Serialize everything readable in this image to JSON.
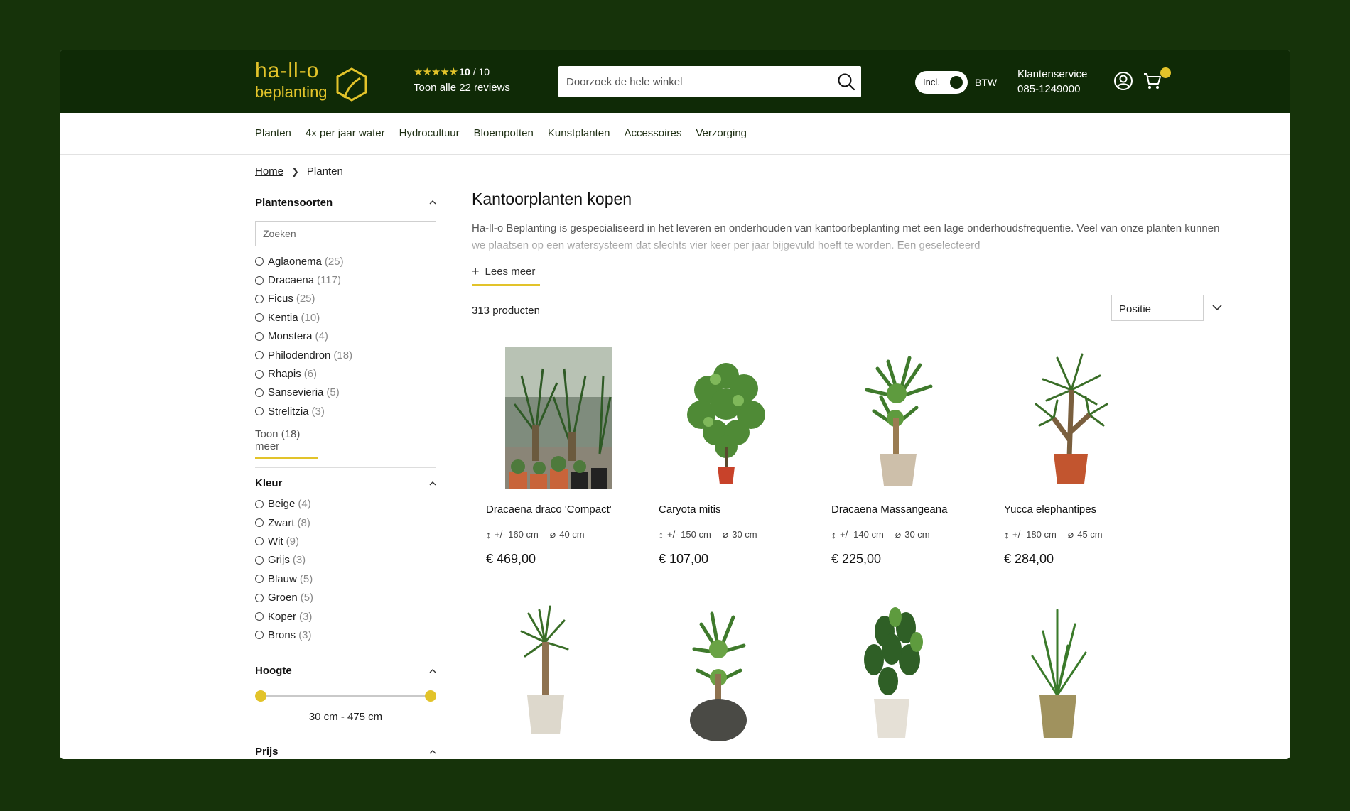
{
  "colors": {
    "header_bg": "#0f2a06",
    "accent": "#e2c32a",
    "page_bg": "#16330a"
  },
  "logo": {
    "line1": "ha-ll-o",
    "line2": "beplanting"
  },
  "rating": {
    "stars": "★★★★★",
    "score": "10",
    "out_of": "/ 10",
    "reviews_link": "Toon alle 22 reviews"
  },
  "search": {
    "placeholder": "Doorzoek de hele winkel",
    "icon": "search-icon"
  },
  "vat_toggle": {
    "label": "Incl.",
    "suffix": "BTW",
    "state": "on"
  },
  "service": {
    "title": "Klantenservice",
    "phone": "085-1249000"
  },
  "header_icons": [
    "user-icon",
    "cart-icon"
  ],
  "nav": {
    "items": [
      "Planten",
      "4x per jaar water",
      "Hydrocultuur",
      "Bloempotten",
      "Kunstplanten",
      "Accessoires",
      "Verzorging"
    ]
  },
  "breadcrumb": {
    "home": "Home",
    "current": "Planten"
  },
  "filters": {
    "plant_types": {
      "title": "Plantensoorten",
      "search_placeholder": "Zoeken",
      "options": [
        {
          "label": "Aglaonema",
          "count": "(25)"
        },
        {
          "label": "Dracaena",
          "count": "(117)"
        },
        {
          "label": "Ficus",
          "count": "(25)"
        },
        {
          "label": "Kentia",
          "count": "(10)"
        },
        {
          "label": "Monstera",
          "count": "(4)"
        },
        {
          "label": "Philodendron",
          "count": "(18)"
        },
        {
          "label": "Rhapis",
          "count": "(6)"
        },
        {
          "label": "Sansevieria",
          "count": "(5)"
        },
        {
          "label": "Strelitzia",
          "count": "(3)"
        }
      ],
      "show_more": "Toon (18) meer"
    },
    "color": {
      "title": "Kleur",
      "options": [
        {
          "label": "Beige",
          "count": "(4)"
        },
        {
          "label": "Zwart",
          "count": "(8)"
        },
        {
          "label": "Wit",
          "count": "(9)"
        },
        {
          "label": "Grijs",
          "count": "(3)"
        },
        {
          "label": "Blauw",
          "count": "(5)"
        },
        {
          "label": "Groen",
          "count": "(5)"
        },
        {
          "label": "Koper",
          "count": "(3)"
        },
        {
          "label": "Brons",
          "count": "(3)"
        }
      ]
    },
    "height": {
      "title": "Hoogte",
      "range_label": "30 cm - 475 cm",
      "min_fraction": 0,
      "max_fraction": 1
    },
    "price": {
      "title": "Prijs"
    }
  },
  "main": {
    "title": "Kantoorplanten kopen",
    "description": "Ha-ll-o Beplanting is gespecialiseerd in het leveren en onderhouden van kantoorbeplanting met een lage onderhoudsfrequentie. Veel van onze planten kunnen we plaatsen op een watersysteem dat slechts vier keer per jaar bijgevuld hoeft te worden. Een geselecteerd",
    "read_more": "Lees meer",
    "product_count": "313 producten",
    "sort": {
      "selected": "Positie"
    }
  },
  "products": [
    {
      "name": "Dracaena draco 'Compact'",
      "height": "+/- 160 cm",
      "diameter": "40 cm",
      "price": "€ 469,00"
    },
    {
      "name": "Caryota mitis",
      "height": "+/- 150 cm",
      "diameter": "30 cm",
      "price": "€ 107,00"
    },
    {
      "name": "Dracaena Massangeana",
      "height": "+/- 140 cm",
      "diameter": "30 cm",
      "price": "€ 225,00"
    },
    {
      "name": "Yucca elephantipes",
      "height": "+/- 180 cm",
      "diameter": "45 cm",
      "price": "€ 284,00"
    }
  ]
}
